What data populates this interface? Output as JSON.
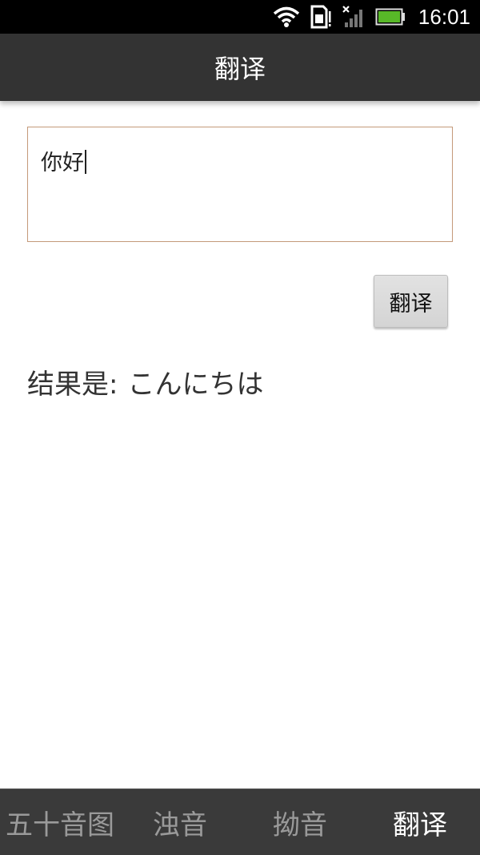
{
  "status_bar": {
    "time": "16:01",
    "icons": [
      "wifi-icon",
      "sim-card-icon",
      "no-signal-icon",
      "battery-icon"
    ],
    "battery_color": "#58b828"
  },
  "header": {
    "title": "翻译"
  },
  "input": {
    "value": "你好"
  },
  "translate_button": {
    "label": "翻译"
  },
  "result": {
    "label": "结果是:",
    "value": "こんにちは"
  },
  "tabs": [
    {
      "label": "五十音图",
      "active": false
    },
    {
      "label": "浊音",
      "active": false
    },
    {
      "label": "拗音",
      "active": false
    },
    {
      "label": "翻译",
      "active": true
    }
  ],
  "colors": {
    "title_bar": "#333333",
    "tab_bar": "#3a3a3a",
    "input_border": "#c49a7a"
  }
}
